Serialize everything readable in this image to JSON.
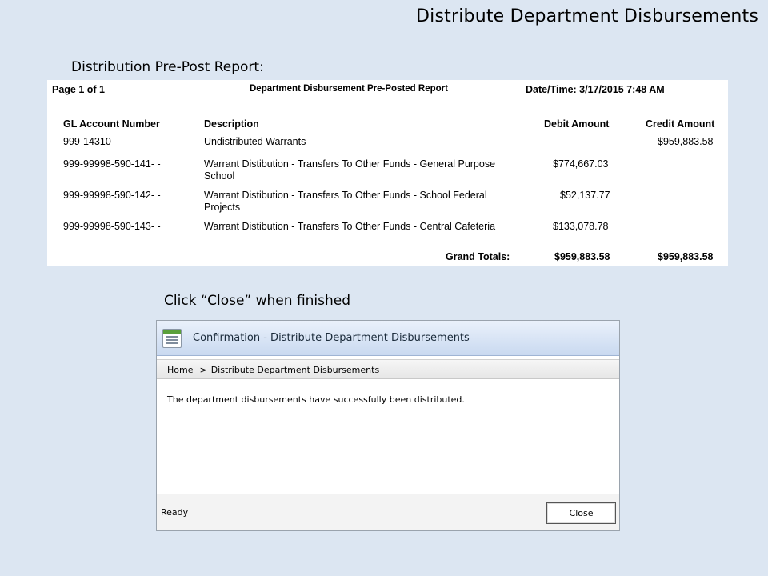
{
  "slide": {
    "title": "Distribute Department Disbursements",
    "report_label": "Distribution Pre-Post Report:",
    "instruction": "Click “Close” when finished"
  },
  "report": {
    "page": "Page 1 of 1",
    "title": "Department Disbursement Pre-Posted Report",
    "datetime": "Date/Time: 3/17/2015 7:48 AM",
    "columns": {
      "account": "GL Account Number",
      "description": "Description",
      "debit": "Debit Amount",
      "credit": "Credit Amount"
    },
    "rows": [
      {
        "account": "999-14310-  -  -  -",
        "description": "Undistributed Warrants",
        "debit": "",
        "credit": "$959,883.58"
      },
      {
        "account": "999-99998-590-141-    -",
        "description": "Warrant Distibution - Transfers To Other Funds - General Purpose School",
        "debit": "$774,667.03",
        "credit": ""
      },
      {
        "account": "999-99998-590-142-    -",
        "description": "Warrant Distibution - Transfers To Other Funds - School Federal Projects",
        "debit": "$52,137.77",
        "credit": ""
      },
      {
        "account": "999-99998-590-143-    -",
        "description": "Warrant Distibution - Transfers To Other Funds - Central Cafeteria",
        "debit": "$133,078.78",
        "credit": ""
      }
    ],
    "totals": {
      "label": "Grand Totals:",
      "debit": "$959,883.58",
      "credit": "$959,883.58"
    }
  },
  "dialog": {
    "title": "Confirmation - Distribute Department Disbursements",
    "breadcrumb": {
      "home": "Home",
      "separator": ">",
      "current": "Distribute Department Disbursements"
    },
    "message": "The department disbursements have successfully been distributed.",
    "status": "Ready",
    "close_label": "Close"
  }
}
